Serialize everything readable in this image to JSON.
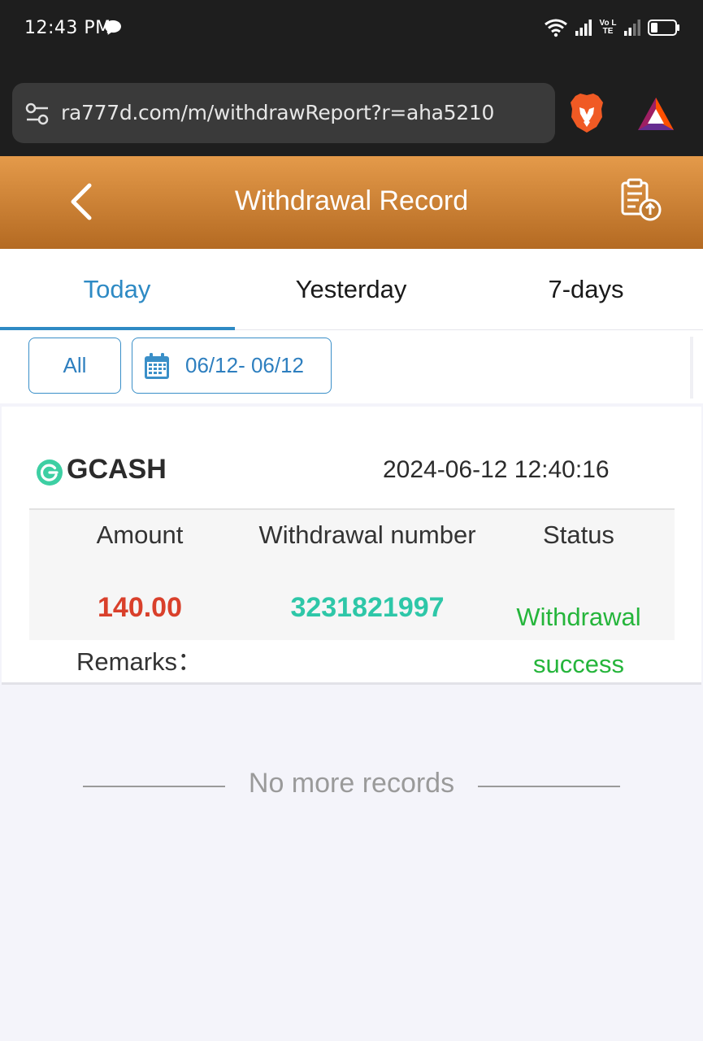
{
  "status_bar": {
    "time": "12:43 PM",
    "network_label": "Vo LTE"
  },
  "browser": {
    "url": "ra777d.com/m/withdrawReport?r=aha5210"
  },
  "header": {
    "title": "Withdrawal Record"
  },
  "tabs": [
    {
      "label": "Today",
      "active": true
    },
    {
      "label": "Yesterday",
      "active": false
    },
    {
      "label": "7-days",
      "active": false
    }
  ],
  "filters": {
    "type_label": "All",
    "date_range": "06/12- 06/12"
  },
  "record": {
    "method": "GCASH",
    "datetime": "2024-06-12 12:40:16",
    "columns": {
      "amount": "Amount",
      "number": "Withdrawal number",
      "status": "Status"
    },
    "amount": "140.00",
    "withdrawal_number": "3231821997",
    "status_line1": "Withdrawal",
    "status_line2": "success",
    "remarks_label": "Remarks："
  },
  "footer": {
    "no_more": "No more records"
  },
  "colors": {
    "header_top": "#e49a4a",
    "header_bottom": "#b46a22",
    "tab_active": "#2e8ac4",
    "amount": "#d9402b",
    "withdrawal_number": "#2ec7a8",
    "status": "#25b53b"
  }
}
